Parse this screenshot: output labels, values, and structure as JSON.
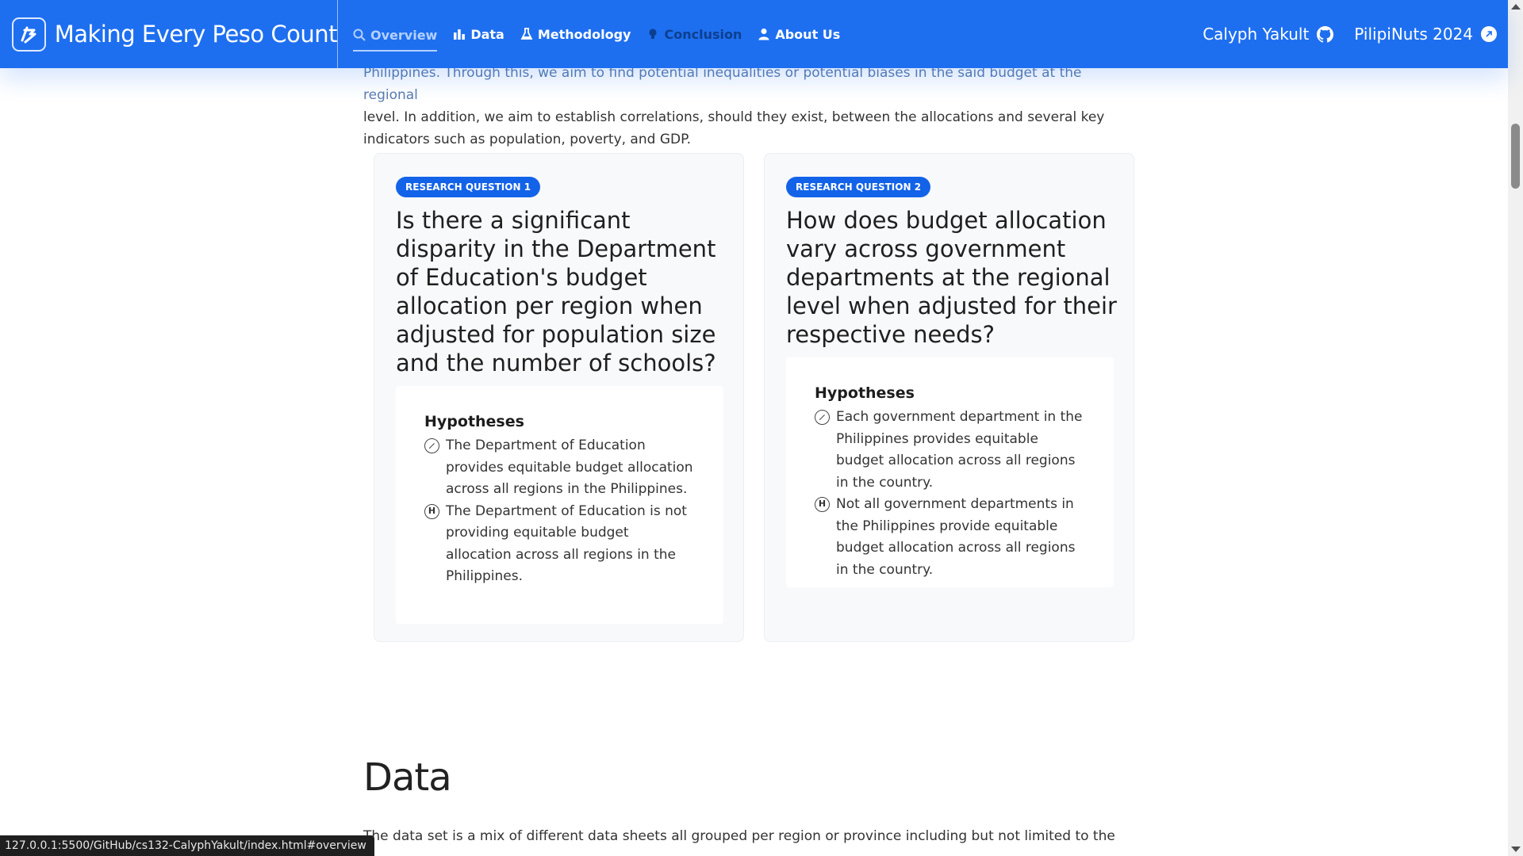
{
  "navbar": {
    "brand_title": "Making Every Peso Count",
    "items": [
      {
        "label": "Overview",
        "icon": "search-icon",
        "state": "active"
      },
      {
        "label": "Data",
        "icon": "bar-chart-icon",
        "state": "normal"
      },
      {
        "label": "Methodology",
        "icon": "flask-icon",
        "state": "normal"
      },
      {
        "label": "Conclusion",
        "icon": "lightbulb-icon",
        "state": "dim"
      },
      {
        "label": "About Us",
        "icon": "user-icon",
        "state": "normal"
      }
    ],
    "right_links": [
      {
        "label": "Calyph Yakult",
        "icon": "github-icon"
      },
      {
        "label": "PilipiNuts 2024",
        "icon": "external-link-icon"
      }
    ],
    "accent": "#1e6ff0"
  },
  "intro": {
    "line1": "Philippines. Through this, we aim to find potential inequalities or potential biases in the said budget at the regional",
    "line2": "level. In addition, we aim to establish correlations, should they exist, between the allocations and several key",
    "line3": "indicators such as population, poverty, and GDP."
  },
  "research_questions": [
    {
      "badge": "RESEARCH QUESTION 1",
      "question": "Is there a significant disparity in the Department of Education's budget allocation per region when adjusted for population size and the number of schools?",
      "hypotheses_title": "Hypotheses",
      "null_hypothesis": "The Department of Education provides equitable budget allocation across all regions in the Philippines.",
      "alt_hypothesis": "The Department of Education is not providing equitable budget allocation across all regions in the Philippines."
    },
    {
      "badge": "RESEARCH QUESTION 2",
      "question": "How does budget allocation vary across government departments at the regional level when adjusted for their respective needs?",
      "hypotheses_title": "Hypotheses",
      "null_hypothesis": "Each government department in the Philippines provides equitable budget allocation across all regions in the country.",
      "alt_hypothesis": "Not all government departments in the Philippines provide equitable budget allocation across all regions in the country."
    }
  ],
  "hypothesis_marks": {
    "alt": "H"
  },
  "data_section": {
    "heading": "Data",
    "text": "The data set is a mix of different data sheets all grouped per region or province including but not limited to the"
  },
  "status_bar": {
    "url": "127.0.0.1:5500/GitHub/cs132-CalyphYakult/index.html#overview"
  }
}
